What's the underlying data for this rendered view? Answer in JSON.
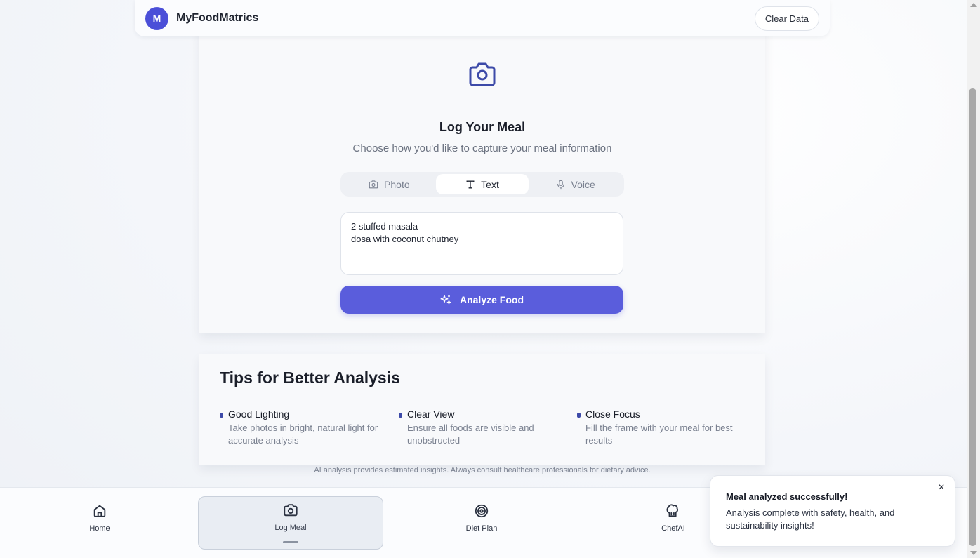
{
  "header": {
    "avatar_initial": "M",
    "app_name": "MyFoodMatrics",
    "clear_label": "Clear Data"
  },
  "log_meal": {
    "title": "Log Your Meal",
    "subtitle": "Choose how you'd like to capture your meal information",
    "tabs": [
      {
        "label": "Photo",
        "icon": "camera-icon",
        "active": false
      },
      {
        "label": "Text",
        "icon": "text-icon",
        "active": true
      },
      {
        "label": "Voice",
        "icon": "mic-icon",
        "active": false
      }
    ],
    "meal_text": "2 stuffed masala\ndosa with coconut chutney",
    "analyze_label": "Analyze Food"
  },
  "tips": {
    "title": "Tips for Better Analysis",
    "items": [
      {
        "head": "Good Lighting",
        "text": "Take photos in bright, natural light for accurate analysis"
      },
      {
        "head": "Clear View",
        "text": "Ensure all foods are visible and unobstructed"
      },
      {
        "head": "Close Focus",
        "text": "Fill the frame with your meal for best results"
      }
    ]
  },
  "disclaimer": "AI analysis provides estimated insights. Always consult healthcare professionals for dietary advice.",
  "nav": [
    {
      "label": "Home",
      "icon": "home-icon",
      "active": false
    },
    {
      "label": "Log Meal",
      "icon": "camera-icon",
      "active": true
    },
    {
      "label": "Diet Plan",
      "icon": "target-icon",
      "active": false
    },
    {
      "label": "ChefAI",
      "icon": "chef-icon",
      "active": false
    }
  ],
  "toast": {
    "title": "Meal analyzed successfully!",
    "body": "Analysis complete with safety, health, and sustainability insights!",
    "close": "×"
  },
  "colors": {
    "accent": "#5a5ddc",
    "avatar": "#4b4fd8",
    "icon_blue": "#3d4aa8"
  }
}
